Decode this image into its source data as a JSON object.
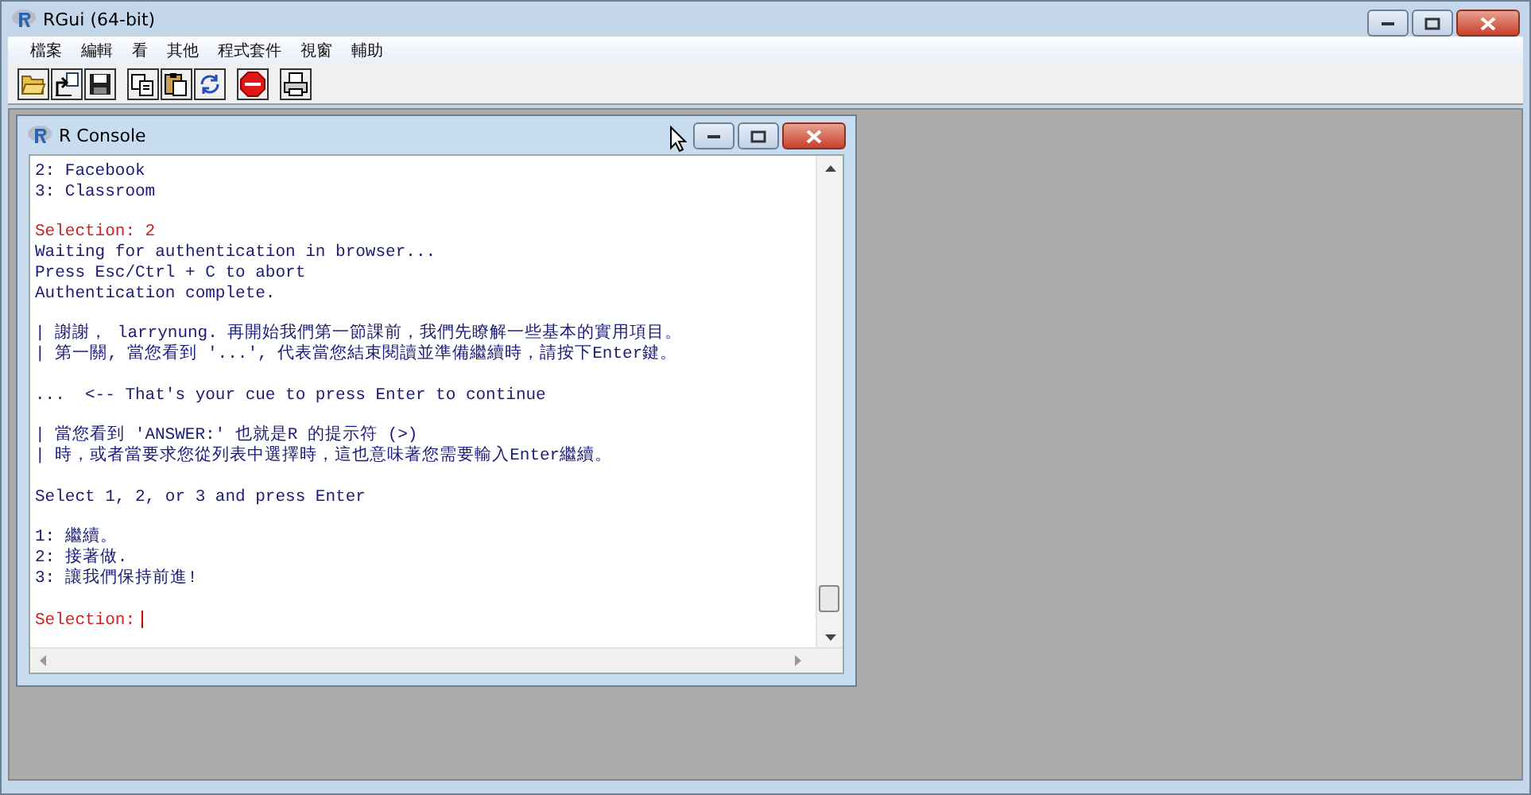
{
  "window": {
    "title": "RGui (64-bit)"
  },
  "menu": [
    "檔案",
    "編輯",
    "看",
    "其他",
    "程式套件",
    "視窗",
    "輔助"
  ],
  "toolbar": [
    {
      "kind": "open"
    },
    {
      "kind": "load"
    },
    {
      "kind": "save"
    },
    {
      "kind": "copy"
    },
    {
      "kind": "paste"
    },
    {
      "kind": "refresh"
    },
    {
      "kind": "stop"
    },
    {
      "kind": "print"
    }
  ],
  "console": {
    "title": "R Console",
    "lines": [
      {
        "kind": "output",
        "text": "2: Facebook"
      },
      {
        "kind": "output",
        "text": "3: Classroom"
      },
      {
        "kind": "blank"
      },
      {
        "kind": "prompt",
        "text": "Selection: 2"
      },
      {
        "kind": "output",
        "text": "Waiting for authentication in browser..."
      },
      {
        "kind": "output",
        "text": "Press Esc/Ctrl + C to abort"
      },
      {
        "kind": "output",
        "text": "Authentication complete."
      },
      {
        "kind": "blank"
      },
      {
        "kind": "output",
        "text": "| 謝謝， larrynung. 再開始我們第一節課前，我們先瞭解一些基本的實用項目。"
      },
      {
        "kind": "output",
        "text": "| 第一關, 當您看到 '...', 代表當您結束閱讀並準備繼續時，請按下Enter鍵。"
      },
      {
        "kind": "blank"
      },
      {
        "kind": "output",
        "text": "...  <-- That's your cue to press Enter to continue"
      },
      {
        "kind": "blank"
      },
      {
        "kind": "output",
        "text": "| 當您看到 'ANSWER:' 也就是R 的提示符 (>)"
      },
      {
        "kind": "output",
        "text": "| 時，或者當要求您從列表中選擇時，這也意味著您需要輸入Enter繼續。"
      },
      {
        "kind": "blank"
      },
      {
        "kind": "output",
        "text": "Select 1, 2, or 3 and press Enter"
      },
      {
        "kind": "blank"
      },
      {
        "kind": "output",
        "text": "1: 繼續。"
      },
      {
        "kind": "output",
        "text": "2: 接著做."
      },
      {
        "kind": "output",
        "text": "3: 讓我們保持前進!"
      },
      {
        "kind": "blank"
      },
      {
        "kind": "prompt",
        "text": "Selection:",
        "cursor": true
      }
    ]
  }
}
